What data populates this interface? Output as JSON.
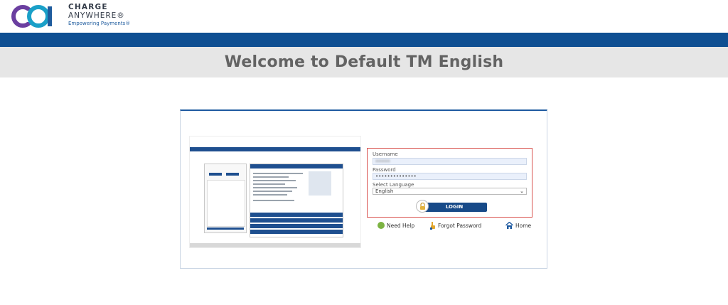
{
  "brand": {
    "line1": "CHARGE",
    "line2": "ANYWHERE®",
    "tagline": "Empowering Payments®",
    "colors": {
      "logo_purple": "#6b3fa0",
      "logo_teal": "#1aa0c8",
      "logo_blue": "#1f5c9e"
    }
  },
  "page": {
    "title": "Welcome to Default TM English",
    "nav_bar_color": "#0f4f92"
  },
  "login": {
    "username_label": "Username",
    "username_value": "•••••",
    "password_label": "Password",
    "password_value": "••••••••••••••",
    "language_label": "Select Language",
    "language_selected": "English",
    "login_button": "LOGIN",
    "highlight_color": "#d9534f"
  },
  "links": {
    "need_help": "Need Help",
    "forgot_password": "Forgot Password",
    "home": "Home"
  }
}
